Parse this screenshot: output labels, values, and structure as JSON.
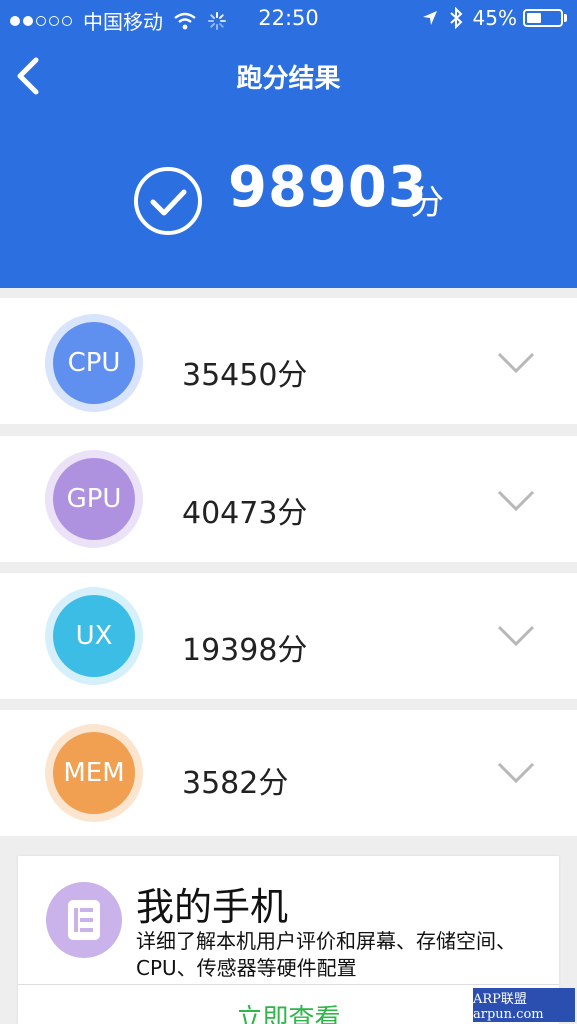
{
  "status": {
    "carrier": "中国移动",
    "time": "22:50",
    "battery_text": "45%",
    "battery_level": 0.45,
    "signal_filled": 2,
    "signal_total": 5
  },
  "nav": {
    "title": "跑分结果"
  },
  "total": {
    "score": "98903",
    "unit": "分"
  },
  "categories": [
    {
      "label": "CPU",
      "score": "35450分",
      "color": "#5f8fef",
      "ring": "#d8e4fb"
    },
    {
      "label": "GPU",
      "score": "40473分",
      "color": "#ae92e0",
      "ring": "#ebe2f7"
    },
    {
      "label": "UX",
      "score": "19398分",
      "color": "#3cbde6",
      "ring": "#d5f0fa"
    },
    {
      "label": "MEM",
      "score": "3582分",
      "color": "#f0a050",
      "ring": "#fbe5cf"
    }
  ],
  "phone": {
    "title": "我的手机",
    "description": "详细了解本机用户评价和屏幕、存储空间、CPU、传感器等硬件配置",
    "action": "立即查看"
  },
  "watermark": "ARP联盟 arpun.com",
  "colors": {
    "header": "#2b6fe0",
    "accent_green": "#2fb54a"
  }
}
